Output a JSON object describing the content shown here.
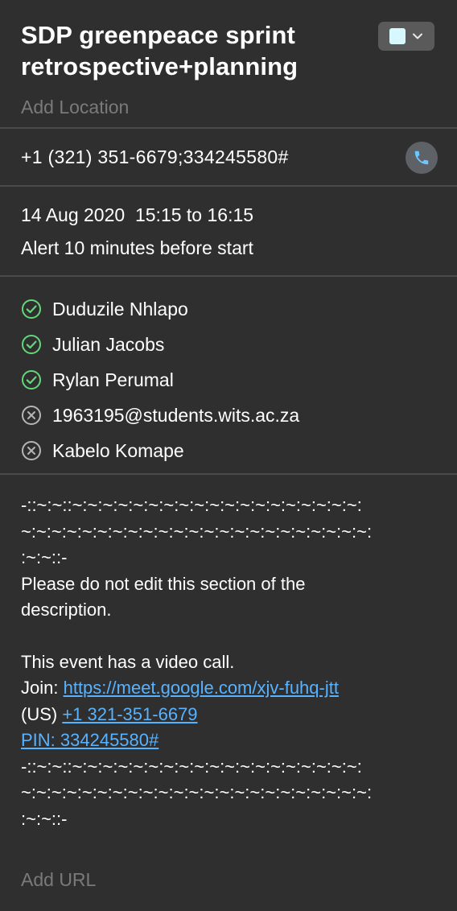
{
  "event": {
    "title": "SDP greenpeace sprint retrospective+planning",
    "location_placeholder": "Add Location",
    "calendar_color": "#d8f8ff"
  },
  "phone": {
    "number": "+1 (321) 351-6679;334245580#",
    "icon": "phone-icon"
  },
  "schedule": {
    "date_time": "14 Aug 2020  15:15 to 16:15",
    "alert": "Alert 10 minutes before start"
  },
  "attendees": [
    {
      "name": "Duduzile Nhlapo",
      "status": "accepted"
    },
    {
      "name": "Julian Jacobs",
      "status": "accepted"
    },
    {
      "name": "Rylan Perumal",
      "status": "accepted"
    },
    {
      "name": "1963195@students.wits.ac.za",
      "status": "declined"
    },
    {
      "name": "Kabelo Komape",
      "status": "declined"
    }
  ],
  "description": {
    "sep1_a": "-::~:~::~:~:~:~:~:~:~:~:~:~:~:~:~:~:~:~:~:~:~:",
    "sep1_b": "~:~:~:~:~:~:~:~:~:~:~:~:~:~:~:~:~:~:~:~:~:~:~:",
    "sep1_c": ":~:~::-",
    "notice": "Please do not edit this section of the description.",
    "video_line": "This event has a video call.",
    "join_label": "Join: ",
    "join_link": "https://meet.google.com/xjv-fuhq-jtt",
    "us_label": "(US) ",
    "us_phone": "+1 321-351-6679",
    "pin": "PIN: 334245580#",
    "sep2_a": "-::~:~::~:~:~:~:~:~:~:~:~:~:~:~:~:~:~:~:~:~:~:",
    "sep2_b": "~:~:~:~:~:~:~:~:~:~:~:~:~:~:~:~:~:~:~:~:~:~:~:",
    "sep2_c": ":~:~::-"
  },
  "url_placeholder": "Add URL",
  "colors": {
    "accepted": "#63d77a",
    "declined": "#b5b5b5",
    "link": "#57b2ff",
    "phone_glyph": "#6cc6ff"
  }
}
